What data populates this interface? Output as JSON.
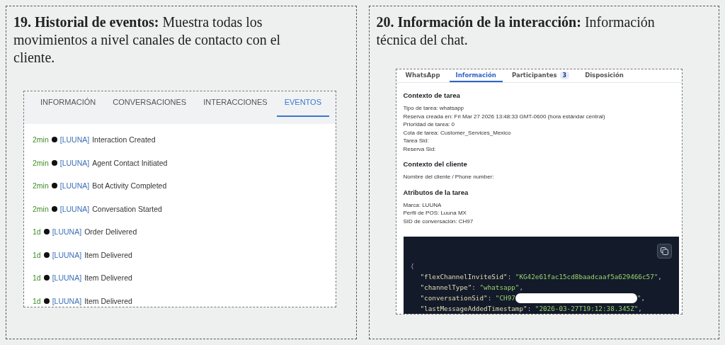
{
  "panels": [
    {
      "caption": "**19. Historial de eventos:** Muestra todas los movimientos a nivel canales de contacto con el cliente.",
      "tabs": [
        {
          "label": "INFORMACIÓN",
          "selected": false
        },
        {
          "label": "CONVERSACIONES",
          "selected": false
        },
        {
          "label": "INTERACCIONES",
          "selected": false
        },
        {
          "label": "EVENTOS",
          "selected": true
        }
      ],
      "events": [
        {
          "time": "2min",
          "brand": "[LUUNA]",
          "text": "Interaction Created"
        },
        {
          "time": "2min",
          "brand": "[LUUNA]",
          "text": "Agent Contact Initiated"
        },
        {
          "time": "2min",
          "brand": "[LUUNA]",
          "text": "Bot Activity Completed"
        },
        {
          "time": "2min",
          "brand": "[LUUNA]",
          "text": "Conversation Started"
        },
        {
          "time": "1d",
          "brand": "[LUUNA]",
          "text": "Order Delivered"
        },
        {
          "time": "1d",
          "brand": "[LUUNA]",
          "text": "Item Delivered"
        },
        {
          "time": "1d",
          "brand": "[LUUNA]",
          "text": "Item Delivered"
        },
        {
          "time": "1d",
          "brand": "[LUUNA]",
          "text": "Item Delivered"
        }
      ]
    },
    {
      "caption": "**20. Información de la interacción:** Información técnica del chat.",
      "tabs": [
        {
          "label": "WhatsApp",
          "selected": false
        },
        {
          "label": "Información",
          "selected": true
        },
        {
          "label": "Participantes",
          "badge": "3",
          "selected": false
        },
        {
          "label": "Disposición",
          "selected": false
        }
      ],
      "sections": [
        {
          "title": "Contexto de tarea",
          "lines": [
            "Tipo de tarea: whatsapp",
            "Reserva creada en: Fri Mar 27 2026 13:48:33 GMT-0600 (hora estándar central)",
            "Prioridad de tarea: 0",
            "Cola de tarea: Customer_Services_Mexico",
            "Tarea Sid:",
            "Reserva Sid:"
          ]
        },
        {
          "title": "Contexto del cliente",
          "lines": [
            "Nombre del cliente / Phone number:"
          ]
        },
        {
          "title": "Atributos de la tarea",
          "lines": [
            "Marca: LUUNA",
            "Perfil de POS: Luuna MX",
            "SID de conversación: CH97"
          ]
        }
      ],
      "code_lines": [
        {
          "kind": "brace",
          "text": "{"
        },
        {
          "kind": "pair",
          "sep": ":",
          "key": "\"flexChannelInviteSid\"",
          "value": "\"KG42e61fac15cd8baadcaaf5a629466c57\"",
          "trail": ","
        },
        {
          "kind": "pair",
          "sep": ":",
          "key": "\"channelType\"",
          "value": "\"whatsapp\"",
          "trail": ","
        },
        {
          "kind": "pair",
          "sep": ":",
          "key": "\"conversationSid\"",
          "value": "\"CH97",
          "redacted": true,
          "value_end": "\"",
          "trail": ","
        },
        {
          "kind": "pair",
          "sep": ":",
          "key": "\"lastMessageAddedTimestamp\"",
          "value": "\"2026-03-27T19:12:38.345Z\"",
          "trail": ","
        }
      ]
    }
  ]
}
